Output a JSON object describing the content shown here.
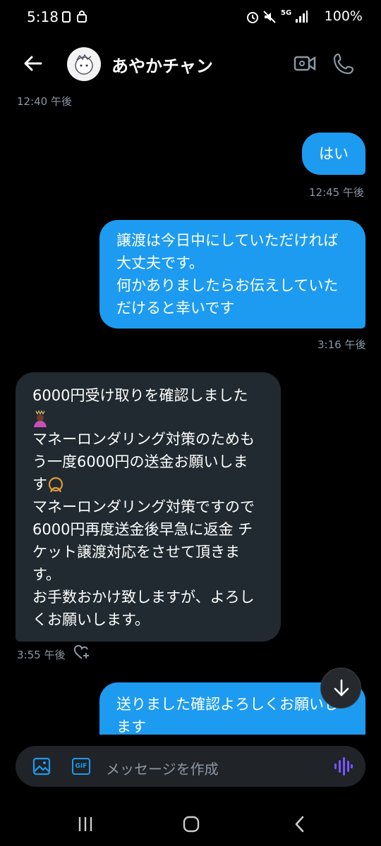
{
  "status_bar": {
    "time": "5:18",
    "network": "5G",
    "battery": "100%"
  },
  "header": {
    "contact_name": "あやかチャン"
  },
  "messages": [
    {
      "direction": "in_timestamp",
      "time": "12:40 午後"
    },
    {
      "direction": "out",
      "text": "はい",
      "time": "12:45 午後"
    },
    {
      "direction": "out",
      "lines": [
        "譲渡は今日中にしていただければ",
        "大丈夫です。",
        "何かありましたらお伝えしていた",
        "だけると幸いです"
      ],
      "time": "3:16 午後"
    },
    {
      "direction": "in",
      "lines": [
        "6000円受け取りを確認しました",
        "マネーロンダリング対策のためも",
        "う一度6000円の送金お願いしま",
        "す",
        "マネーロンダリング対策ですので",
        "6000円再度送金後早急に返金 チ",
        "ケット譲渡対応をさせて頂きま",
        "す。",
        "お手数おかけ致しますが、よろし",
        "くお願いします。"
      ],
      "time": "3:55 午後"
    },
    {
      "direction": "out",
      "lines": [
        "送りました確認よろしくお願いし",
        "ます"
      ]
    }
  ],
  "composer": {
    "placeholder": "メッセージを作成",
    "gif_label": "GIF"
  },
  "icons": {
    "back": "arrow-left-icon",
    "video": "video-camera-icon",
    "call": "phone-icon",
    "image": "image-icon",
    "gif": "gif-icon",
    "voice": "voice-wave-icon",
    "scroll": "arrow-down-icon",
    "reaction": "heart-plus-icon"
  },
  "colors": {
    "accent": "#1d9bf0",
    "incoming_bubble": "#202a30",
    "muted": "#8b98a5",
    "voice": "#7856ff"
  }
}
